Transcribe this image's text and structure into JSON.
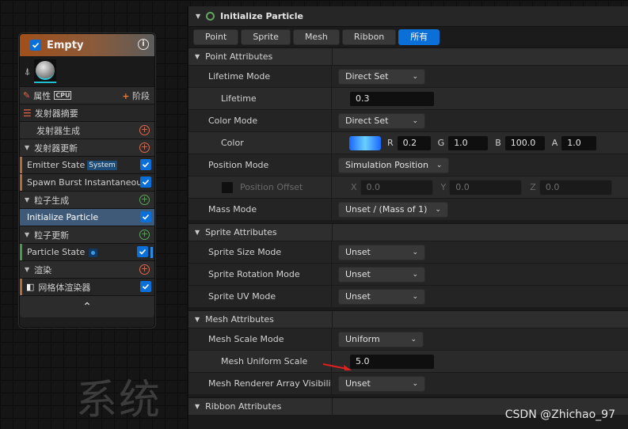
{
  "background_text": "系统",
  "watermark": "CSDN @Zhichao_97",
  "node": {
    "title": "Empty",
    "properties_label": "属性",
    "cpu_label": "CPU",
    "stage_label": "阶段",
    "rows": [
      {
        "label": "发射器摘要",
        "kind": "summary"
      },
      {
        "label": "发射器生成",
        "kind": "sub"
      },
      {
        "label": "发射器更新",
        "kind": "group"
      },
      {
        "label": "Emitter State",
        "badge": "System",
        "kind": "item",
        "bar": "#b56a3e"
      },
      {
        "label": "Spawn Burst Instantaneous",
        "kind": "item",
        "bar": "#b56a3e"
      },
      {
        "label": "粒子生成",
        "kind": "group"
      },
      {
        "label": "Initialize Particle",
        "kind": "item",
        "selected": true
      },
      {
        "label": "粒子更新",
        "kind": "group"
      },
      {
        "label": "Particle State",
        "kind": "item",
        "bar": "#4a9a4a"
      },
      {
        "label": "渲染",
        "kind": "group"
      },
      {
        "label": "网格体渲染器",
        "kind": "item"
      }
    ]
  },
  "panel": {
    "title": "Initialize Particle",
    "tabs": [
      "Point",
      "Sprite",
      "Mesh",
      "Ribbon",
      "所有"
    ],
    "sections": {
      "point": "Point Attributes",
      "sprite": "Sprite Attributes",
      "mesh": "Mesh Attributes",
      "ribbon": "Ribbon Attributes"
    },
    "lifetime_mode": {
      "label": "Lifetime Mode",
      "value": "Direct Set"
    },
    "lifetime": {
      "label": "Lifetime",
      "value": "0.3"
    },
    "color_mode": {
      "label": "Color Mode",
      "value": "Direct Set"
    },
    "color": {
      "label": "Color",
      "r_label": "R",
      "r": "0.2",
      "g_label": "G",
      "g": "1.0",
      "b_label": "B",
      "b": "100.0",
      "a_label": "A",
      "a": "1.0"
    },
    "position_mode": {
      "label": "Position Mode",
      "value": "Simulation Position"
    },
    "position_offset": {
      "label": "Position Offset",
      "x_label": "X",
      "x": "0.0",
      "y_label": "Y",
      "y": "0.0",
      "z_label": "Z",
      "z": "0.0"
    },
    "mass_mode": {
      "label": "Mass Mode",
      "value": "Unset / (Mass of 1)"
    },
    "sprite_size_mode": {
      "label": "Sprite Size Mode",
      "value": "Unset"
    },
    "sprite_rotation_mode": {
      "label": "Sprite Rotation Mode",
      "value": "Unset"
    },
    "sprite_uv_mode": {
      "label": "Sprite UV Mode",
      "value": "Unset"
    },
    "mesh_scale_mode": {
      "label": "Mesh Scale Mode",
      "value": "Uniform"
    },
    "mesh_uniform_scale": {
      "label": "Mesh Uniform Scale",
      "value": "5.0"
    },
    "mesh_renderer_visibility": {
      "label": "Mesh Renderer Array Visibility",
      "value": "Unset"
    }
  }
}
